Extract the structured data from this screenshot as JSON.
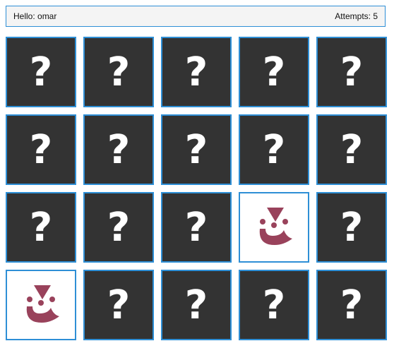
{
  "header": {
    "greeting": "Hello: omar",
    "attempts": "Attempts: 5"
  },
  "colors": {
    "card_back": "#333333",
    "card_border": "#2e8fd6",
    "header_bg": "#f4f4f4",
    "face_icon": "#99425b"
  },
  "board": {
    "hidden_symbol": "?",
    "face_icon_name": "jester-icon",
    "cards": [
      {
        "state": "hidden"
      },
      {
        "state": "hidden"
      },
      {
        "state": "hidden"
      },
      {
        "state": "hidden"
      },
      {
        "state": "hidden"
      },
      {
        "state": "hidden"
      },
      {
        "state": "hidden"
      },
      {
        "state": "hidden"
      },
      {
        "state": "hidden"
      },
      {
        "state": "hidden"
      },
      {
        "state": "hidden"
      },
      {
        "state": "hidden"
      },
      {
        "state": "hidden"
      },
      {
        "state": "revealed",
        "icon": "jester-icon"
      },
      {
        "state": "hidden"
      },
      {
        "state": "revealed",
        "icon": "jester-icon"
      },
      {
        "state": "hidden"
      },
      {
        "state": "hidden"
      },
      {
        "state": "hidden"
      },
      {
        "state": "hidden"
      }
    ]
  }
}
